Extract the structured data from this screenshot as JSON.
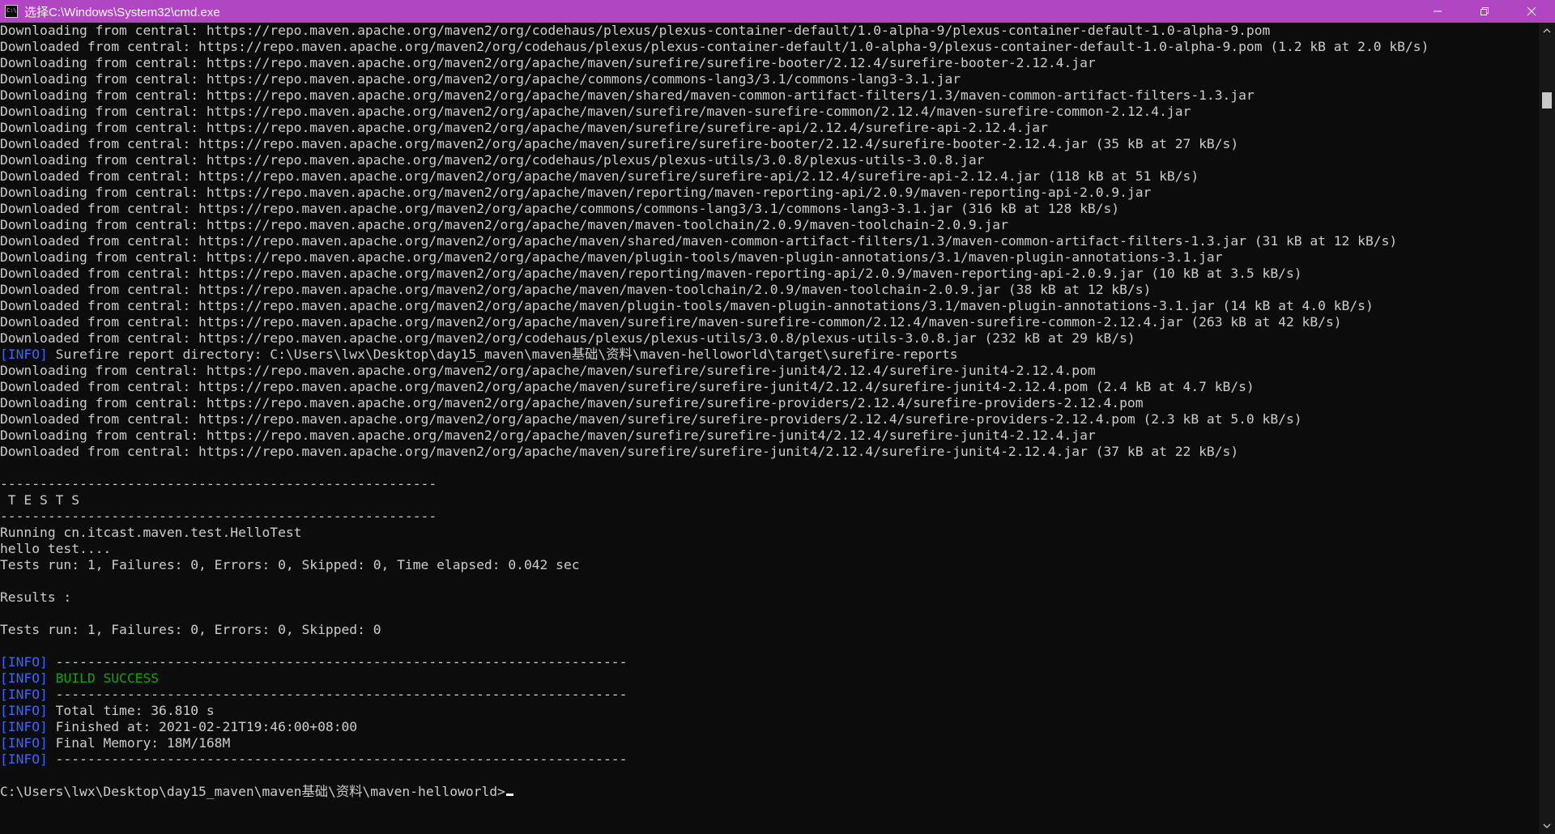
{
  "window": {
    "title": "选择C:\\Windows\\System32\\cmd.exe",
    "app_icon_text": "C:\\",
    "controls": [
      "minimize-icon",
      "restore-icon",
      "close-icon"
    ]
  },
  "console": {
    "lines": [
      {
        "text": "Downloading from central: https://repo.maven.apache.org/maven2/org/codehaus/plexus/plexus-container-default/1.0-alpha-9/plexus-container-default-1.0-alpha-9.pom"
      },
      {
        "text": "Downloaded from central: https://repo.maven.apache.org/maven2/org/codehaus/plexus/plexus-container-default/1.0-alpha-9/plexus-container-default-1.0-alpha-9.pom (1.2 kB at 2.0 kB/s)"
      },
      {
        "text": "Downloading from central: https://repo.maven.apache.org/maven2/org/apache/maven/surefire/surefire-booter/2.12.4/surefire-booter-2.12.4.jar"
      },
      {
        "text": "Downloading from central: https://repo.maven.apache.org/maven2/org/apache/commons/commons-lang3/3.1/commons-lang3-3.1.jar"
      },
      {
        "text": "Downloading from central: https://repo.maven.apache.org/maven2/org/apache/maven/shared/maven-common-artifact-filters/1.3/maven-common-artifact-filters-1.3.jar"
      },
      {
        "text": "Downloading from central: https://repo.maven.apache.org/maven2/org/apache/maven/surefire/maven-surefire-common/2.12.4/maven-surefire-common-2.12.4.jar"
      },
      {
        "text": "Downloading from central: https://repo.maven.apache.org/maven2/org/apache/maven/surefire/surefire-api/2.12.4/surefire-api-2.12.4.jar"
      },
      {
        "text": "Downloaded from central: https://repo.maven.apache.org/maven2/org/apache/maven/surefire/surefire-booter/2.12.4/surefire-booter-2.12.4.jar (35 kB at 27 kB/s)"
      },
      {
        "text": "Downloading from central: https://repo.maven.apache.org/maven2/org/codehaus/plexus/plexus-utils/3.0.8/plexus-utils-3.0.8.jar"
      },
      {
        "text": "Downloaded from central: https://repo.maven.apache.org/maven2/org/apache/maven/surefire/surefire-api/2.12.4/surefire-api-2.12.4.jar (118 kB at 51 kB/s)"
      },
      {
        "text": "Downloading from central: https://repo.maven.apache.org/maven2/org/apache/maven/reporting/maven-reporting-api/2.0.9/maven-reporting-api-2.0.9.jar"
      },
      {
        "text": "Downloaded from central: https://repo.maven.apache.org/maven2/org/apache/commons/commons-lang3/3.1/commons-lang3-3.1.jar (316 kB at 128 kB/s)"
      },
      {
        "text": "Downloading from central: https://repo.maven.apache.org/maven2/org/apache/maven/maven-toolchain/2.0.9/maven-toolchain-2.0.9.jar"
      },
      {
        "text": "Downloaded from central: https://repo.maven.apache.org/maven2/org/apache/maven/shared/maven-common-artifact-filters/1.3/maven-common-artifact-filters-1.3.jar (31 kB at 12 kB/s)"
      },
      {
        "text": "Downloading from central: https://repo.maven.apache.org/maven2/org/apache/maven/plugin-tools/maven-plugin-annotations/3.1/maven-plugin-annotations-3.1.jar"
      },
      {
        "text": "Downloaded from central: https://repo.maven.apache.org/maven2/org/apache/maven/reporting/maven-reporting-api/2.0.9/maven-reporting-api-2.0.9.jar (10 kB at 3.5 kB/s)"
      },
      {
        "text": "Downloaded from central: https://repo.maven.apache.org/maven2/org/apache/maven/maven-toolchain/2.0.9/maven-toolchain-2.0.9.jar (38 kB at 12 kB/s)"
      },
      {
        "text": "Downloaded from central: https://repo.maven.apache.org/maven2/org/apache/maven/plugin-tools/maven-plugin-annotations/3.1/maven-plugin-annotations-3.1.jar (14 kB at 4.0 kB/s)"
      },
      {
        "text": "Downloaded from central: https://repo.maven.apache.org/maven2/org/apache/maven/surefire/maven-surefire-common/2.12.4/maven-surefire-common-2.12.4.jar (263 kB at 42 kB/s)"
      },
      {
        "text": "Downloaded from central: https://repo.maven.apache.org/maven2/org/codehaus/plexus/plexus-utils/3.0.8/plexus-utils-3.0.8.jar (232 kB at 29 kB/s)"
      },
      {
        "prefix": "[INFO]",
        "text": " Surefire report directory: C:\\Users\\lwx\\Desktop\\day15_maven\\maven基础\\资料\\maven-helloworld\\target\\surefire-reports"
      },
      {
        "text": "Downloading from central: https://repo.maven.apache.org/maven2/org/apache/maven/surefire/surefire-junit4/2.12.4/surefire-junit4-2.12.4.pom"
      },
      {
        "text": "Downloaded from central: https://repo.maven.apache.org/maven2/org/apache/maven/surefire/surefire-junit4/2.12.4/surefire-junit4-2.12.4.pom (2.4 kB at 4.7 kB/s)"
      },
      {
        "text": "Downloading from central: https://repo.maven.apache.org/maven2/org/apache/maven/surefire/surefire-providers/2.12.4/surefire-providers-2.12.4.pom"
      },
      {
        "text": "Downloaded from central: https://repo.maven.apache.org/maven2/org/apache/maven/surefire/surefire-providers/2.12.4/surefire-providers-2.12.4.pom (2.3 kB at 5.0 kB/s)"
      },
      {
        "text": "Downloading from central: https://repo.maven.apache.org/maven2/org/apache/maven/surefire/surefire-junit4/2.12.4/surefire-junit4-2.12.4.jar"
      },
      {
        "text": "Downloaded from central: https://repo.maven.apache.org/maven2/org/apache/maven/surefire/surefire-junit4/2.12.4/surefire-junit4-2.12.4.jar (37 kB at 22 kB/s)"
      },
      {
        "text": ""
      },
      {
        "text": "-------------------------------------------------------"
      },
      {
        "text": " T E S T S"
      },
      {
        "text": "-------------------------------------------------------"
      },
      {
        "text": "Running cn.itcast.maven.test.HelloTest"
      },
      {
        "text": "hello test...."
      },
      {
        "text": "Tests run: 1, Failures: 0, Errors: 0, Skipped: 0, Time elapsed: 0.042 sec"
      },
      {
        "text": ""
      },
      {
        "text": "Results :"
      },
      {
        "text": ""
      },
      {
        "text": "Tests run: 1, Failures: 0, Errors: 0, Skipped: 0"
      },
      {
        "text": ""
      },
      {
        "prefix": "[INFO]",
        "text": " ------------------------------------------------------------------------"
      },
      {
        "prefix": "[INFO]",
        "text": " ",
        "highlight": "BUILD SUCCESS"
      },
      {
        "prefix": "[INFO]",
        "text": " ------------------------------------------------------------------------"
      },
      {
        "prefix": "[INFO]",
        "text": " Total time: 36.810 s"
      },
      {
        "prefix": "[INFO]",
        "text": " Finished at: 2021-02-21T19:46:00+08:00"
      },
      {
        "prefix": "[INFO]",
        "text": " Final Memory: 18M/168M"
      },
      {
        "prefix": "[INFO]",
        "text": " ------------------------------------------------------------------------"
      },
      {
        "text": ""
      },
      {
        "text": "C:\\Users\\lwx\\Desktop\\day15_maven\\maven基础\\资料\\maven-helloworld>",
        "cursor": true
      }
    ]
  },
  "colors": {
    "titlebar": "#b146c2",
    "background": "#0c0c0c",
    "text": "#cccccc",
    "info": "#3a66ff",
    "success": "#13a10e"
  },
  "scrollbar": {
    "icons": [
      "scroll-up-arrow-icon",
      "scroll-down-arrow-icon"
    ]
  }
}
